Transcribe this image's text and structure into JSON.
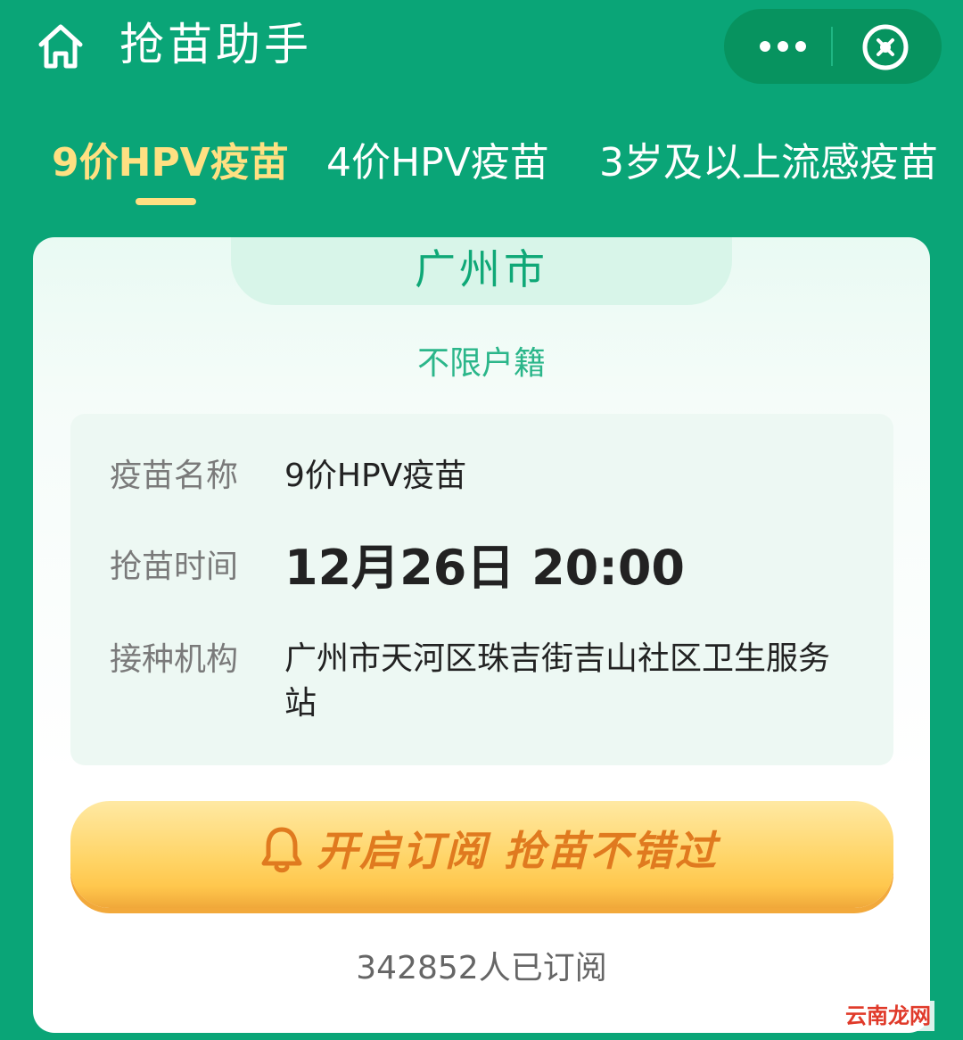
{
  "topbar": {
    "title": "抢苗助手",
    "icons": {
      "home": "home-icon",
      "more": "more-icon",
      "close": "close-icon"
    }
  },
  "tabs": [
    {
      "label": "9价HPV疫苗",
      "active": true
    },
    {
      "label": "4价HPV疫苗",
      "active": false
    },
    {
      "label": "3岁及以上流感疫苗",
      "active": false
    }
  ],
  "card": {
    "city": "广州市",
    "restriction": "不限户籍",
    "info": {
      "vaccine_name_label": "疫苗名称",
      "vaccine_name_value": "9价HPV疫苗",
      "time_label": "抢苗时间",
      "time_value": "12月26日 20:00",
      "institution_label": "接种机构",
      "institution_value": "广州市天河区珠吉街吉山社区卫生服务站"
    },
    "subscribe_button": "开启订阅 抢苗不错过",
    "subscriber_count": "342852人已订阅"
  },
  "watermark": "云南龙网",
  "colors": {
    "brand_green": "#0aa577",
    "tab_active": "#ffe082",
    "city_text": "#0fa877",
    "button_orange": "#e07a1f"
  }
}
